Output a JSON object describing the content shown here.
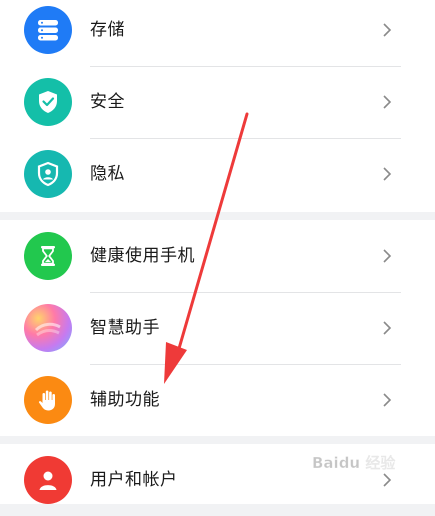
{
  "settings": {
    "items": [
      {
        "label": "存储",
        "icon": "storage-icon",
        "color": "#1f7bf6"
      },
      {
        "label": "安全",
        "icon": "security-shield-icon",
        "color": "#14bfa8"
      },
      {
        "label": "隐私",
        "icon": "privacy-icon",
        "color": "#16b8b0"
      },
      {
        "label": "健康使用手机",
        "icon": "hourglass-icon",
        "color": "#22c84e"
      },
      {
        "label": "智慧助手",
        "icon": "smart-assistant-icon",
        "color": "#c97ae6"
      },
      {
        "label": "辅助功能",
        "icon": "hand-icon",
        "color": "#fb8a12"
      },
      {
        "label": "用户和帐户",
        "icon": "user-icon",
        "color": "#f03a34"
      }
    ]
  },
  "annotation": {
    "arrow_color": "#ee3a3a"
  },
  "watermark": {
    "text": "Baidu 经验"
  }
}
